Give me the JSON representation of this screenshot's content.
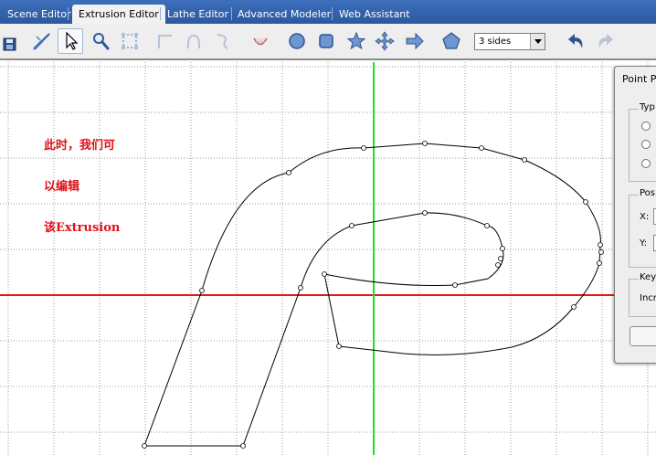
{
  "tabs": [
    {
      "label": "Scene Editor",
      "active": false
    },
    {
      "label": "Extrusion Editor",
      "active": true
    },
    {
      "label": "Lathe Editor",
      "active": false
    },
    {
      "label": "Advanced Modeler",
      "active": false
    },
    {
      "label": "Web Assistant",
      "active": false
    }
  ],
  "toolbar": {
    "sides_value": "3 sides",
    "icons": [
      "save-icon",
      "brush-icon",
      "arrow-select-icon",
      "zoom-icon",
      "box-select-icon",
      "corner-icon",
      "arc-icon",
      "curve-icon",
      "smile-icon",
      "circle-shape-icon",
      "square-shape-icon",
      "star-shape-icon",
      "cross-arrows-icon",
      "arrow-shape-icon",
      "pentagon-shape-icon",
      "undo-icon",
      "redo-icon"
    ]
  },
  "annotation": {
    "lines": [
      "此时，我们可",
      "以编辑",
      "该Extrusion"
    ]
  },
  "point_panel": {
    "title": "Point P",
    "type_label": "Typ",
    "position_label": "Pos",
    "x_label": "X:",
    "y_label": "Y:",
    "key_label": "Key",
    "increment_label": "Incr"
  },
  "colors": {
    "tabbar": "#2f5fa8",
    "x_axis": "#e8141a",
    "y_axis": "#22e01e",
    "grid": "#9a9a9a",
    "note": "#e0101a"
  }
}
